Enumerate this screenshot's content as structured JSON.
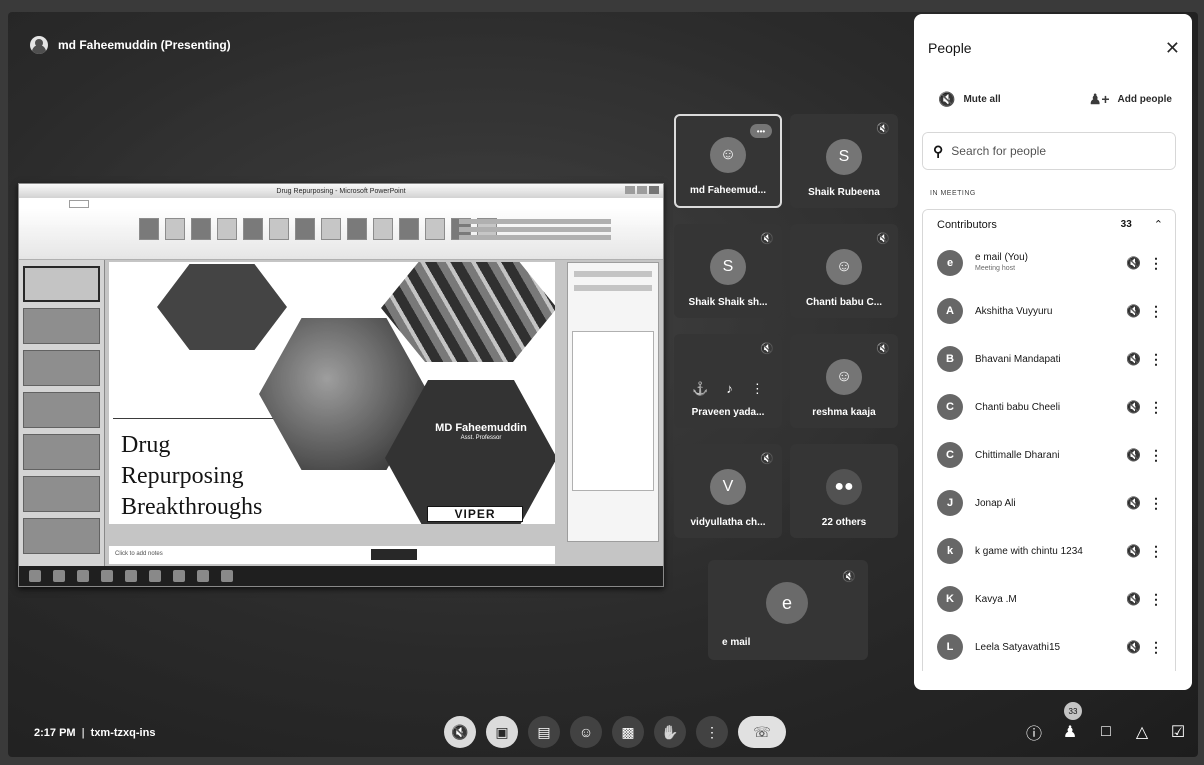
{
  "presenter": {
    "label": "md Faheemuddin (Presenting)"
  },
  "presentation": {
    "window_title": "Drug Repurposing - Microsoft PowerPoint",
    "slide_title_lines": [
      "Drug",
      "Repurposing",
      "Breakthroughs"
    ],
    "author_name": "MD Faheemuddin",
    "author_sub": "Asst. Professor",
    "logo_text": "VIPER",
    "notes_placeholder": "Click to add notes"
  },
  "tiles": [
    {
      "name": "md Faheemud...",
      "initial": ""
    },
    {
      "name": "Shaik Rubeena",
      "initial": "S"
    },
    {
      "name": "Shaik Shaik sh...",
      "initial": "S"
    },
    {
      "name": "Chanti babu C...",
      "initial": ""
    },
    {
      "name": "Praveen yada...",
      "initial": ""
    },
    {
      "name": "reshma kaaja",
      "initial": ""
    },
    {
      "name": "vidyullatha ch...",
      "initial": "V"
    },
    {
      "name": "22 others",
      "initial": ""
    }
  ],
  "big_tile": {
    "name": "e mail",
    "initial": "e"
  },
  "people_panel": {
    "title": "People",
    "mute_all": "Mute all",
    "add_people": "Add people",
    "search_placeholder": "Search for people",
    "in_meeting_label": "IN MEETING",
    "contributors_label": "Contributors",
    "contributors_count": "33",
    "people": [
      {
        "name": "e mail (You)",
        "sub": "Meeting host",
        "initial": "e"
      },
      {
        "name": "Akshitha Vuyyuru",
        "sub": "",
        "initial": "A"
      },
      {
        "name": "Bhavani Mandapati",
        "sub": "",
        "initial": "B"
      },
      {
        "name": "Chanti babu Cheeli",
        "sub": "",
        "initial": "C"
      },
      {
        "name": "Chittimalle Dharani",
        "sub": "",
        "initial": "C"
      },
      {
        "name": "Jonap Ali",
        "sub": "",
        "initial": "J"
      },
      {
        "name": "k game with chintu 1234",
        "sub": "",
        "initial": "k"
      },
      {
        "name": "Kavya .M",
        "sub": "",
        "initial": "K"
      },
      {
        "name": "Leela Satyavathi15",
        "sub": "",
        "initial": "L"
      }
    ]
  },
  "meeting": {
    "time": "2:17 PM",
    "code": "txm-tzxq-ins",
    "people_count": "33"
  }
}
